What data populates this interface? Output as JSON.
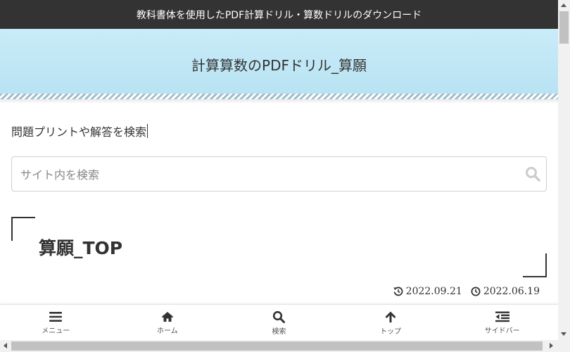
{
  "banner": {
    "text": "教科書体を使用したPDF計算ドリル・算数ドリルのダウンロード"
  },
  "header": {
    "site_title": "計算算数のPDFドリル_算願"
  },
  "search": {
    "label": "問題プリントや解答を検索",
    "placeholder": "サイト内を検索",
    "value": ""
  },
  "article": {
    "title": "算願_TOP",
    "updated_date": "2022.09.21",
    "published_date": "2022.06.19"
  },
  "footer_nav": {
    "items": [
      {
        "label": "メニュー",
        "icon": "menu-icon"
      },
      {
        "label": "ホーム",
        "icon": "home-icon"
      },
      {
        "label": "検索",
        "icon": "search-icon"
      },
      {
        "label": "トップ",
        "icon": "arrow-up-icon"
      },
      {
        "label": "サイドバー",
        "icon": "sidebar-icon"
      }
    ]
  },
  "colors": {
    "banner_bg": "#333333",
    "header_bg": "#c9ecf8",
    "text": "#333333"
  }
}
